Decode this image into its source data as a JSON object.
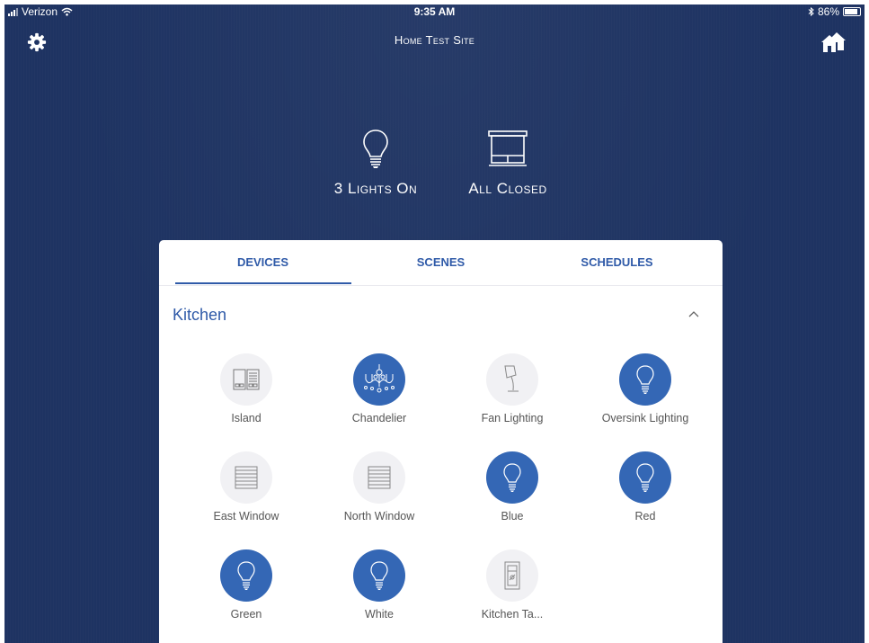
{
  "status_bar": {
    "carrier": "Verizon",
    "time": "9:35 AM",
    "battery": "86%"
  },
  "header": {
    "title": "Home Test Site",
    "settings_icon": "gear-icon",
    "home_icon": "houses-icon"
  },
  "summary": {
    "lights": "3 Lights On",
    "shades": "All Closed"
  },
  "tabs": [
    {
      "label": "DEVICES",
      "active": true
    },
    {
      "label": "SCENES",
      "active": false
    },
    {
      "label": "SCHEDULES",
      "active": false
    }
  ],
  "section": {
    "title": "Kitchen"
  },
  "devices": [
    {
      "label": "Island",
      "icon": "keypad-icon",
      "on": false
    },
    {
      "label": "Chandelier",
      "icon": "chandelier-icon",
      "on": true
    },
    {
      "label": "Fan Lighting",
      "icon": "lamp-icon",
      "on": false
    },
    {
      "label": "Oversink Lighting",
      "icon": "bulb-icon",
      "on": true
    },
    {
      "label": "East Window",
      "icon": "shade-icon",
      "on": false
    },
    {
      "label": "North Window",
      "icon": "shade-icon",
      "on": false
    },
    {
      "label": "Blue",
      "icon": "bulb-icon",
      "on": true
    },
    {
      "label": "Red",
      "icon": "bulb-icon",
      "on": true
    },
    {
      "label": "Green",
      "icon": "bulb-icon",
      "on": true
    },
    {
      "label": "White",
      "icon": "bulb-icon",
      "on": true
    },
    {
      "label": "Kitchen Ta...",
      "icon": "switch-icon",
      "on": false
    }
  ],
  "colors": {
    "background": "#1e3362",
    "accent": "#2f5aa8",
    "on_circle": "#3467b5",
    "off_circle": "#f1f1f4"
  }
}
